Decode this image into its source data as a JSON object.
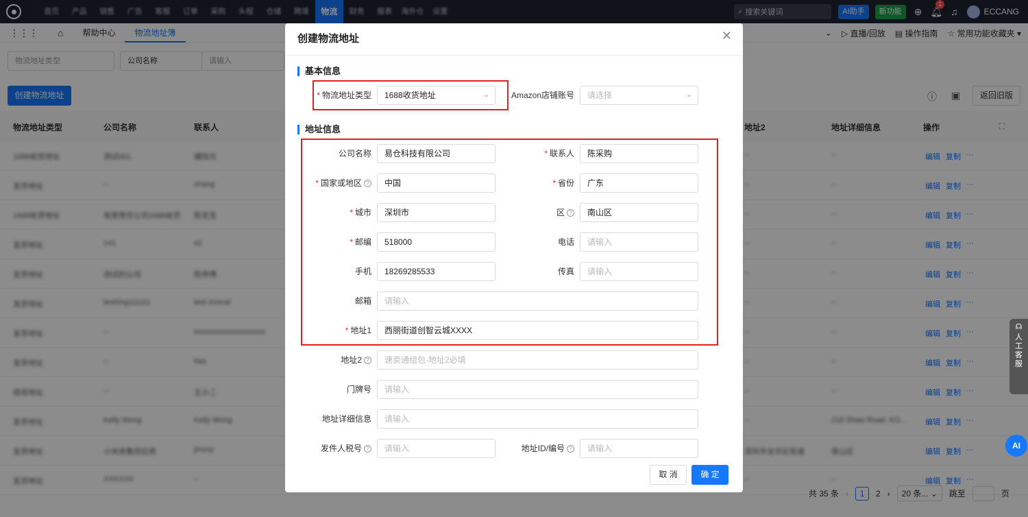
{
  "topnav": {
    "items": [
      "首页",
      "产品",
      "销售",
      "广告",
      "客服",
      "订单",
      "采购",
      "头程",
      "仓储",
      "跨境",
      "物流",
      "财务",
      "报表",
      "海外仓",
      "设置"
    ],
    "active": "物流",
    "search_placeholder": "搜索关键词",
    "ai_label": "AI助手",
    "new_label": "新功能",
    "notif_count": "1",
    "username": "ECCANG"
  },
  "tabs": {
    "home_icon": "home-icon",
    "items": [
      "帮助中心",
      "物流地址簿"
    ],
    "active": "物流地址簿",
    "live": "直播/回放",
    "guide": "操作指南",
    "favorites": "常用功能收藏夹"
  },
  "filter": {
    "type_placeholder": "物流地址类型",
    "company_label": "公司名称",
    "input_placeholder": "请输入"
  },
  "toolbar": {
    "create_label": "创建物流地址",
    "old_label": "返回旧版"
  },
  "table": {
    "headers": [
      "物流地址类型",
      "公司名称",
      "联系人",
      "地址2",
      "地址详细信息",
      "操作"
    ],
    "rows": [
      [
        "1688收货地址",
        "测试001",
        "捕快光",
        "--",
        "--"
      ],
      [
        "发货地址",
        "--",
        "zhang",
        "--",
        "--"
      ],
      [
        "1688收货地址",
        "有限责任公司1688收货",
        "陈克克",
        "--",
        "--"
      ],
      [
        "发货地址",
        "141",
        "41",
        "--",
        "--"
      ],
      [
        "发货地址",
        "测试的公司",
        "陈师傅",
        "--",
        "--"
      ],
      [
        "发货地址",
        "test0ng111111",
        "test zoncat",
        "--",
        "--"
      ],
      [
        "发货地址",
        "--",
        "xxxxxxxxxxxxxxxxxxx",
        "--",
        "--"
      ],
      [
        "发货地址",
        "--",
        "tiaa",
        "--",
        "--"
      ],
      [
        "揽收地址",
        "--",
        "王小二",
        "--",
        "--"
      ],
      [
        "发货地址",
        "Kelly Wong",
        "Kelly Wong",
        "--",
        "218 Shaw Road, KO..."
      ],
      [
        "发货地址",
        "小米收集供应商",
        "jimmy",
        "深圳市龙华区街道",
        "南山区"
      ],
      [
        "发货地址",
        "XXXXXX",
        "--",
        "--",
        "--"
      ]
    ],
    "op_edit": "编辑",
    "op_copy": "复制",
    "op_more": "···"
  },
  "pagination": {
    "total": "共 35 条",
    "pages": [
      "1",
      "2"
    ],
    "page_size": "20 条...",
    "goto": "跳至",
    "page_unit": "页"
  },
  "side": {
    "service": "人工客服",
    "ai": "AI"
  },
  "modal": {
    "title": "创建物流地址",
    "section_basic": "基本信息",
    "section_address": "地址信息",
    "fields": {
      "type_label": "物流地址类型",
      "type_value": "1688收货地址",
      "amazon_label": "Amazon店铺账号",
      "amazon_placeholder": "请选择",
      "company_label": "公司名称",
      "company_value": "易仓科技有限公司",
      "contact_label": "联系人",
      "contact_value": "陈采购",
      "country_label": "国家或地区",
      "country_value": "中国",
      "province_label": "省份",
      "province_value": "广东",
      "city_label": "城市",
      "city_value": "深圳市",
      "district_label": "区",
      "district_value": "南山区",
      "zip_label": "邮编",
      "zip_value": "518000",
      "phone_label": "电话",
      "phone_placeholder": "请输入",
      "mobile_label": "手机",
      "mobile_value": "18269285533",
      "fax_label": "传真",
      "fax_placeholder": "请输入",
      "email_label": "邮箱",
      "email_placeholder": "请输入",
      "addr1_label": "地址1",
      "addr1_value": "西丽街道创智云城XXXX",
      "addr2_label": "地址2",
      "addr2_placeholder": "速卖通组包-地址2必填",
      "door_label": "门牌号",
      "door_placeholder": "请输入",
      "detail_label": "地址详细信息",
      "detail_placeholder": "请输入",
      "tax_label": "发件人税号",
      "tax_placeholder": "请输入",
      "addrid_label": "地址ID/编号",
      "addrid_placeholder": "请输入"
    },
    "cancel_label": "取 消",
    "ok_label": "确 定"
  },
  "colors": {
    "primary": "#1677ff",
    "highlight": "#e02020",
    "topbar": "#1f2330"
  }
}
